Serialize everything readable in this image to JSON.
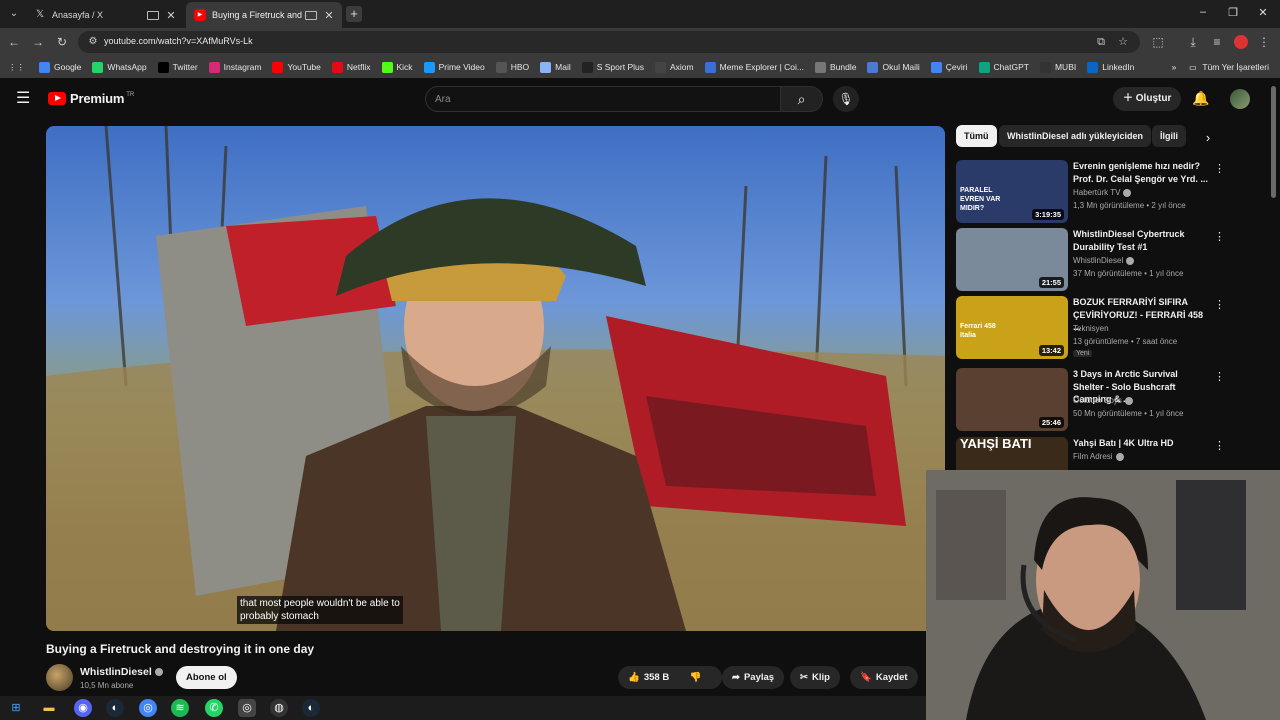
{
  "browser": {
    "tabs": [
      {
        "title": "Anasayfa / X",
        "favicon": "x-logo-icon",
        "active": false
      },
      {
        "title": "Buying a Firetruck and dest",
        "favicon": "youtube-icon",
        "active": true
      }
    ],
    "url": "youtube.com/watch?v=XAfMuRVs-Lk",
    "bookmarks": [
      {
        "label": "Google",
        "icon": "google-icon",
        "color": "#4285f4"
      },
      {
        "label": "WhatsApp",
        "icon": "whatsapp-icon",
        "color": "#25d366"
      },
      {
        "label": "Twitter",
        "icon": "x-logo-icon",
        "color": "#000000"
      },
      {
        "label": "Instagram",
        "icon": "instagram-icon",
        "color": "#d62976"
      },
      {
        "label": "YouTube",
        "icon": "youtube-icon",
        "color": "#ff0000"
      },
      {
        "label": "Netflix",
        "icon": "netflix-icon",
        "color": "#e50914"
      },
      {
        "label": "Kick",
        "icon": "kick-icon",
        "color": "#53fc18"
      },
      {
        "label": "Prime Video",
        "icon": "prime-icon",
        "color": "#1a98ff"
      },
      {
        "label": "HBO",
        "icon": "hbo-icon",
        "color": "#555555"
      },
      {
        "label": "Mail",
        "icon": "mail-icon",
        "color": "#8ab4f8"
      },
      {
        "label": "S Sport Plus",
        "icon": "ssport-icon",
        "color": "#222222"
      },
      {
        "label": "Axiom",
        "icon": "axiom-icon",
        "color": "#444444"
      },
      {
        "label": "Meme Explorer | Coi...",
        "icon": "meme-icon",
        "color": "#3b6fd8"
      },
      {
        "label": "Bundle",
        "icon": "bundle-icon",
        "color": "#777777"
      },
      {
        "label": "Okul Maili",
        "icon": "okul-icon",
        "color": "#4a7bd0"
      },
      {
        "label": "Çeviri",
        "icon": "translate-icon",
        "color": "#4285f4"
      },
      {
        "label": "ChatGPT",
        "icon": "chatgpt-icon",
        "color": "#10a37f"
      },
      {
        "label": "MUBI",
        "icon": "mubi-icon",
        "color": "#333333"
      },
      {
        "label": "LinkedIn",
        "icon": "linkedin-icon",
        "color": "#0a66c2"
      }
    ],
    "all_bookmarks": "Tüm Yer İşaretleri"
  },
  "yt": {
    "brand": "Premium",
    "brand_tr": "TR",
    "search_placeholder": "Ara",
    "create_label": "Oluştur",
    "video": {
      "caption_line1": "that most people wouldn't be able to",
      "caption_line2": "probably stomach",
      "title": "Buying a Firetruck and destroying it in one day",
      "channel": "WhistlinDiesel",
      "subscribers": "10,5 Mn abone",
      "subscribe_label": "Abone ol",
      "likes": "358 B",
      "share_label": "Paylaş",
      "clip_label": "Klip",
      "save_label": "Kaydet"
    },
    "chips": [
      "Tümü",
      "WhistlinDiesel adlı yükleyiciden",
      "İlgili"
    ],
    "recommendations": [
      {
        "title": "Evrenin genişleme hızı nedir? Prof. Dr. Celal Şengör ve Yrd. ...",
        "channel": "Habertürk TV",
        "verified": true,
        "meta": "1,3 Mn görüntüleme • 2 yıl önce",
        "duration": "3:19:35",
        "thumb_color": "#2a3b6a",
        "thumb_text": "PARALEL EVREN VAR MIDIR?",
        "badge": ""
      },
      {
        "title": "WhistlinDiesel Cybertruck Durability Test #1",
        "channel": "WhistlinDiesel",
        "verified": true,
        "meta": "37 Mn görüntüleme • 1 yıl önce",
        "duration": "21:55",
        "thumb_color": "#7a8a9a",
        "thumb_text": "",
        "badge": ""
      },
      {
        "title": "BOZUK FERRARİYİ SIFIRA ÇEVİRİYORUZ! - FERRARİ 458 ...",
        "channel": "Teknisyen",
        "verified": false,
        "meta": "13 görüntüleme • 7 saat önce",
        "duration": "13:42",
        "thumb_color": "#c9a21a",
        "thumb_text": "Ferrari 458 Italia",
        "badge": "Yeni"
      },
      {
        "title": "3 Days in Arctic Survival Shelter - Solo Bushcraft Camping & ...",
        "channel": "Outdoor Boys",
        "verified": true,
        "meta": "50 Mn görüntüleme • 1 yıl önce",
        "duration": "25:46",
        "thumb_color": "#5a4030",
        "thumb_text": "",
        "badge": ""
      },
      {
        "title": "Yahşi Batı | 4K Ultra HD",
        "channel": "Film Adresi",
        "verified": true,
        "meta": "",
        "duration": "",
        "thumb_color": "#3a2a1a",
        "thumb_text": "YAHŞİ BATI",
        "badge": ""
      }
    ]
  }
}
